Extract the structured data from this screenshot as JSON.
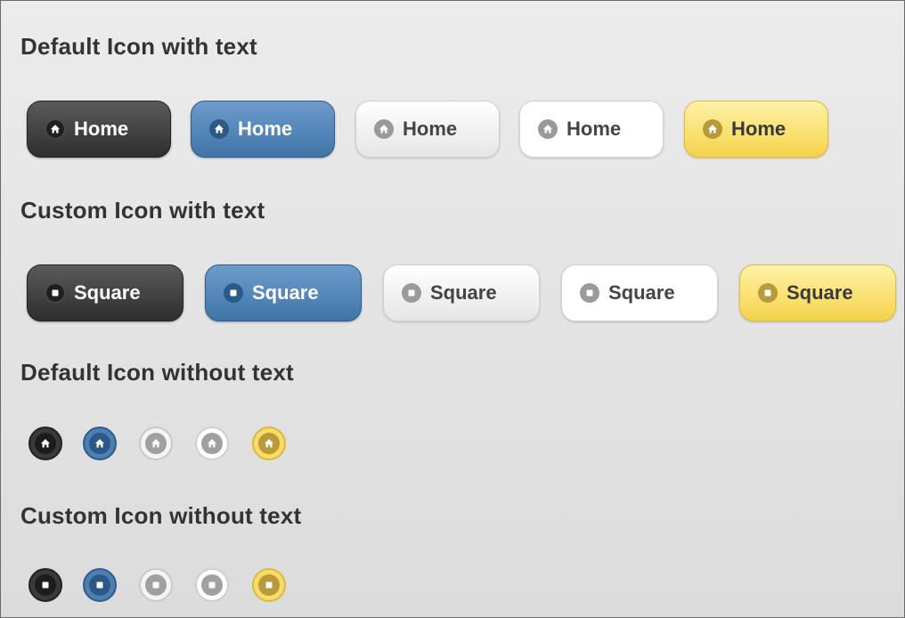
{
  "sections": [
    {
      "title": "Default Icon with text",
      "variant": "labeled",
      "icon": "home-icon",
      "buttons": [
        {
          "label": "Home",
          "theme": "dark"
        },
        {
          "label": "Home",
          "theme": "blue"
        },
        {
          "label": "Home",
          "theme": "light"
        },
        {
          "label": "Home",
          "theme": "white"
        },
        {
          "label": "Home",
          "theme": "yellow"
        }
      ]
    },
    {
      "title": "Custom Icon with text",
      "variant": "labeled",
      "icon": "square-icon",
      "buttons": [
        {
          "label": "Square",
          "theme": "dark"
        },
        {
          "label": "Square",
          "theme": "blue"
        },
        {
          "label": "Square",
          "theme": "light"
        },
        {
          "label": "Square",
          "theme": "white"
        },
        {
          "label": "Square",
          "theme": "yellow"
        }
      ]
    },
    {
      "title": "Default Icon without text",
      "variant": "icon-only",
      "icon": "home-icon",
      "buttons": [
        {
          "theme": "dark"
        },
        {
          "theme": "blue"
        },
        {
          "theme": "light"
        },
        {
          "theme": "white"
        },
        {
          "theme": "yellow"
        }
      ]
    },
    {
      "title": "Custom Icon without text",
      "variant": "icon-only",
      "icon": "square-icon",
      "buttons": [
        {
          "theme": "dark"
        },
        {
          "theme": "blue"
        },
        {
          "theme": "light"
        },
        {
          "theme": "white"
        },
        {
          "theme": "yellow"
        }
      ]
    }
  ],
  "colors": {
    "dark": "#3a3a3a",
    "blue": "#4c7fb3",
    "light": "#f2f2f2",
    "white": "#ffffff",
    "yellow": "#f7dc6a",
    "title_text": "#333333"
  }
}
